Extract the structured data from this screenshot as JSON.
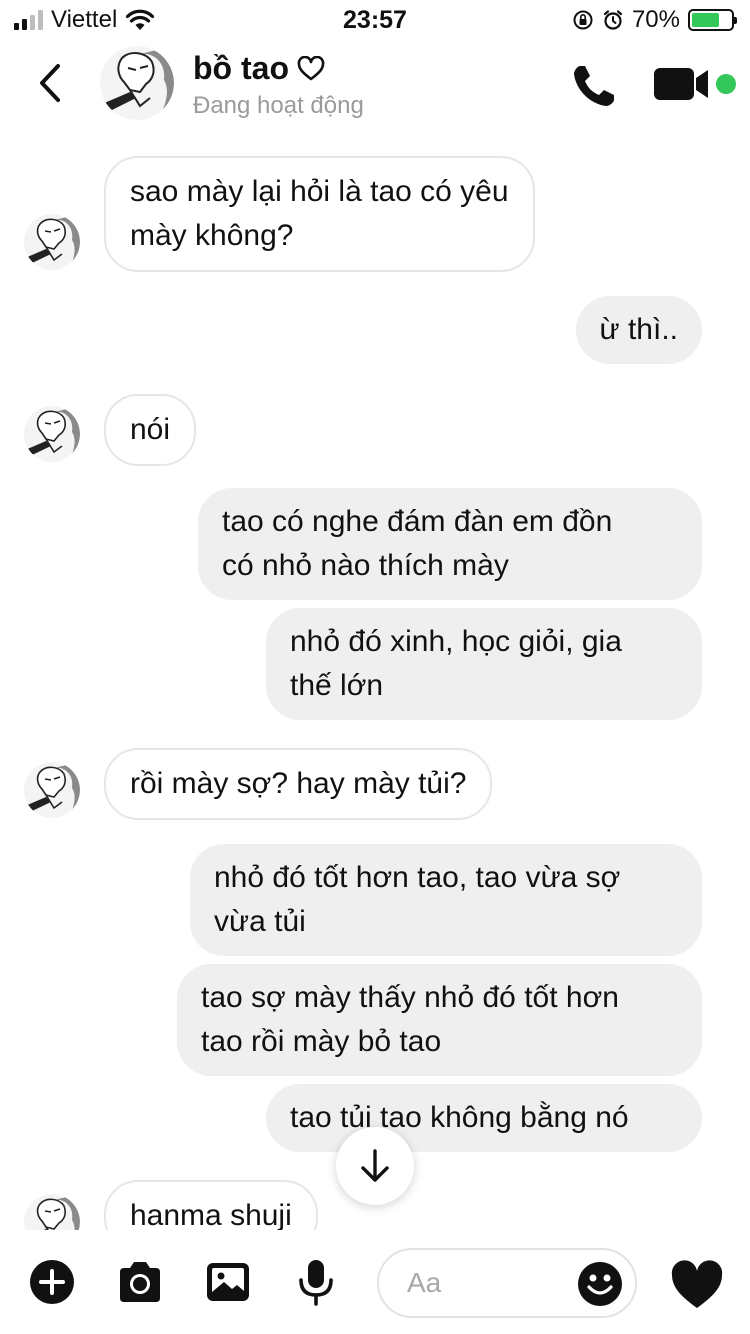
{
  "status_bar": {
    "carrier": "Viettel",
    "time": "23:57",
    "battery": "70%",
    "battery_level": 0.7,
    "signal_bars_active": 2,
    "signal_bars_total": 4
  },
  "header": {
    "name": "bồ tao",
    "presence": "Đang hoạt động",
    "icons": [
      "back-icon",
      "heart-outline-icon",
      "phone-icon",
      "video-icon"
    ],
    "online_color": "#34c759"
  },
  "messages": [
    {
      "dir": "in",
      "lines": [
        "sao mày lại hỏi là tao có yêu",
        "mày không?"
      ],
      "has_avatar": true
    },
    {
      "dir": "out",
      "lines": [
        "ừ thì.."
      ]
    },
    {
      "dir": "in",
      "lines": [
        "nói"
      ],
      "has_avatar": true
    },
    {
      "dir": "out",
      "lines": [
        "tao có nghe đám đàn em đồn",
        "có nhỏ nào thích mày"
      ]
    },
    {
      "dir": "out",
      "lines": [
        "nhỏ đó xinh, học giỏi, gia",
        "thế lớn"
      ]
    },
    {
      "dir": "in",
      "lines": [
        "rồi mày sợ? hay mày tủi?"
      ],
      "has_avatar": true
    },
    {
      "dir": "out",
      "lines": [
        "nhỏ đó tốt hơn tao, tao vừa sợ",
        "vừa tủi"
      ]
    },
    {
      "dir": "out",
      "lines": [
        "tao sợ mày thấy nhỏ đó tốt hơn",
        "tao rồi mày bỏ tao"
      ]
    },
    {
      "dir": "out",
      "lines": [
        "tao tủi tao không bằng nó"
      ]
    },
    {
      "dir": "in",
      "lines": [
        "hanma shuji"
      ],
      "has_avatar": true
    }
  ],
  "composer": {
    "placeholder": "Aa",
    "icons": [
      "plus-icon",
      "camera-icon",
      "gallery-icon",
      "microphone-icon",
      "emoji-icon",
      "heart-icon"
    ]
  },
  "colors": {
    "outgoing_bubble": "#efefef",
    "incoming_border": "#e6e6e6",
    "text": "#111111",
    "muted": "#9a9a9a"
  }
}
